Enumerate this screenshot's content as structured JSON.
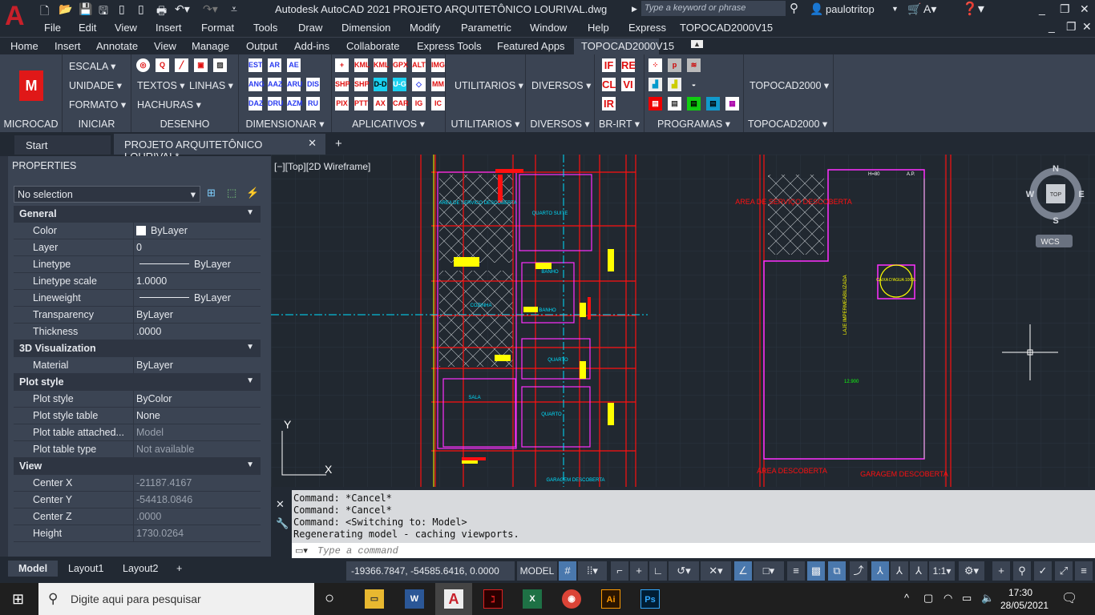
{
  "app": {
    "title": "Autodesk AutoCAD 2021    PROJETO ARQUITETÔNICO LOURIVAL.dwg",
    "logo": "A",
    "search_placeholder": "Type a keyword or phrase",
    "user": "paulotritop"
  },
  "menubar": [
    "File",
    "Edit",
    "View",
    "Insert",
    "Format",
    "Tools",
    "Draw",
    "Dimension",
    "Modify",
    "Parametric",
    "Window",
    "Help",
    "Express",
    "TOPOCAD2000V15"
  ],
  "ribbon_tabs": [
    "Home",
    "Insert",
    "Annotate",
    "View",
    "Manage",
    "Output",
    "Add-ins",
    "Collaborate",
    "Express Tools",
    "Featured Apps",
    "TOPOCAD2000V15"
  ],
  "active_ribbon_tab": "TOPOCAD2000V15",
  "ribbon": {
    "microcad": {
      "title": "MICROCAD"
    },
    "iniciar": {
      "title": "INICIAR",
      "buttons": [
        "ESCALA",
        "UNIDADE",
        "FORMATO"
      ]
    },
    "desenho": {
      "title": "DESENHO",
      "buttons": [
        "TEXTOS",
        "LINHAS",
        "HACHURAS"
      ]
    },
    "dimensionar": {
      "title": "DIMENSIONAR",
      "icons": [
        "EST",
        "AR",
        "AE",
        "ANG",
        "AAZ",
        "ARU",
        "DIS",
        "DAZ",
        "DRU",
        "AZM",
        "RU"
      ]
    },
    "aplicativos": {
      "title": "APLICATIVOS",
      "icons": [
        "+",
        "KML",
        "KML",
        "GPX",
        "ALT",
        "IMG",
        "SHP",
        "SHP",
        "D-D",
        "U-G",
        "",
        "MM",
        "PIX",
        "PTT",
        "AX",
        "CAR",
        "IG",
        "IC"
      ]
    },
    "utilitarios": {
      "title": "UTILITARIOS",
      "button": "UTILITARIOS"
    },
    "diversos": {
      "title": "DIVERSOS",
      "button": "DIVERSOS"
    },
    "brirt": {
      "title": "BR-IRT",
      "icons": [
        "IF",
        "RE",
        "CL",
        "VI",
        "IR"
      ]
    },
    "programas": {
      "title": "PROGRAMAS"
    },
    "topocad": {
      "title": "TOPOCAD2000",
      "button": "TOPOCAD2000"
    }
  },
  "doc_tabs": {
    "start": "Start",
    "active": "PROJETO ARQUITETÔNICO LOURIVAL*"
  },
  "properties": {
    "title": "PROPERTIES",
    "selection": "No selection",
    "sections": [
      {
        "name": "General",
        "rows": [
          [
            "Color",
            "ByLayer"
          ],
          [
            "Layer",
            "0"
          ],
          [
            "Linetype",
            "ByLayer"
          ],
          [
            "Linetype scale",
            "1.0000"
          ],
          [
            "Lineweight",
            "ByLayer"
          ],
          [
            "Transparency",
            "ByLayer"
          ],
          [
            "Thickness",
            ".0000"
          ]
        ]
      },
      {
        "name": "3D Visualization",
        "rows": [
          [
            "Material",
            "ByLayer"
          ]
        ]
      },
      {
        "name": "Plot style",
        "rows": [
          [
            "Plot style",
            "ByColor"
          ],
          [
            "Plot style table",
            "None"
          ],
          [
            "Plot table attached...",
            "Model"
          ],
          [
            "Plot table type",
            "Not available"
          ]
        ]
      },
      {
        "name": "View",
        "rows": [
          [
            "Center X",
            "-21187.4167"
          ],
          [
            "Center Y",
            "-54418.0846"
          ],
          [
            "Center Z",
            ".0000"
          ],
          [
            "Height",
            "1730.0264"
          ]
        ]
      }
    ]
  },
  "viewport": {
    "label": "[−][Top][2D Wireframe]",
    "compass": {
      "n": "N",
      "s": "S",
      "e": "E",
      "w": "W",
      "top": "TOP"
    },
    "ucs": "WCS",
    "ucs_y": "Y",
    "ucs_x": "X",
    "labels": [
      "AREA DE SERVICO DESCOBERTA",
      "QUARTO SUITE",
      "BANHO",
      "COZINHA",
      "BANHO",
      "QUARTO",
      "SALA",
      "QUARTO",
      "GARAGEM DESCOBERTA",
      "AREA DE SERVIÇO DESCOBERTA",
      "CAIXA D'AGUA 1000L",
      "LAJE IMPERMEABILIZADA",
      "AREA DESCOBERTA",
      "GARAGEM DESCOBERTA",
      "H=80",
      "A.P.",
      "12.900"
    ]
  },
  "command": {
    "history": [
      "Command: *Cancel*",
      "Command: *Cancel*",
      "Command:   <Switching to: Model>",
      "Regenerating model - caching viewports."
    ],
    "placeholder": "Type a command"
  },
  "layout_tabs": [
    "Model",
    "Layout1",
    "Layout2"
  ],
  "status": {
    "coords": "-19366.7847, -54585.6416, 0.0000",
    "model": "MODEL",
    "scale": "1:1"
  },
  "taskbar": {
    "search": "Digite aqui para pesquisar",
    "time": "17:30",
    "date": "28/05/2021"
  }
}
